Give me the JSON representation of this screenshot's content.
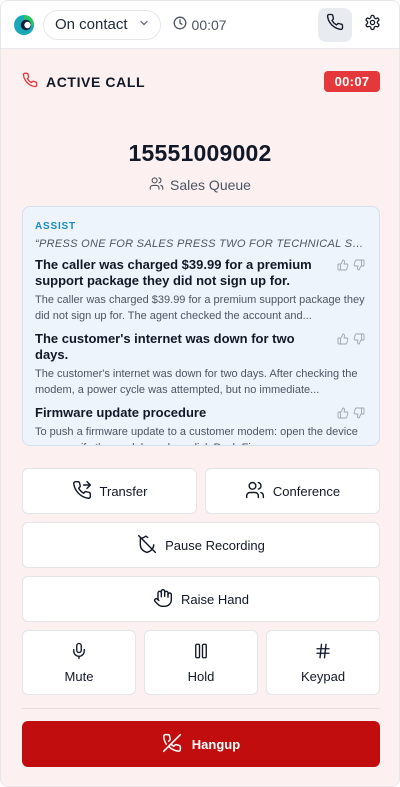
{
  "header": {
    "status": "On contact",
    "call_timer": "00:07"
  },
  "call": {
    "label": "ACTIVE CALL",
    "badge_timer": "00:07",
    "number": "15551009002",
    "queue": "Sales Queue"
  },
  "assist": {
    "title": "ASSIST",
    "quote": "“PRESS ONE FOR SALES PRESS TWO FOR TECHNICAL SUPPORT”",
    "suggestions": [
      {
        "title": "The caller was charged $39.99 for a premium support package they did not sign up for.",
        "body": "The caller was charged $39.99 for a premium support package they did not sign up for. The agent checked the account and..."
      },
      {
        "title": "The customer's internet was down for two days.",
        "body": "The customer's internet was down for two days. After checking the modem, a power cycle was attempted, but no immediate..."
      },
      {
        "title": "Firmware update procedure",
        "body": "To push a firmware update to a customer modem: open the device page, verify the model number, click Push Firmware,..."
      }
    ]
  },
  "actions": {
    "transfer": "Transfer",
    "conference": "Conference",
    "pause_recording": "Pause Recording",
    "raise_hand": "Raise Hand",
    "mute": "Mute",
    "hold": "Hold",
    "keypad": "Keypad",
    "hangup": "Hangup"
  },
  "colors": {
    "accent_red": "#e5383b",
    "hangup_red": "#c10d0d",
    "assist_blue": "#1a8ac2",
    "panel_bg": "#fdf0f0"
  }
}
